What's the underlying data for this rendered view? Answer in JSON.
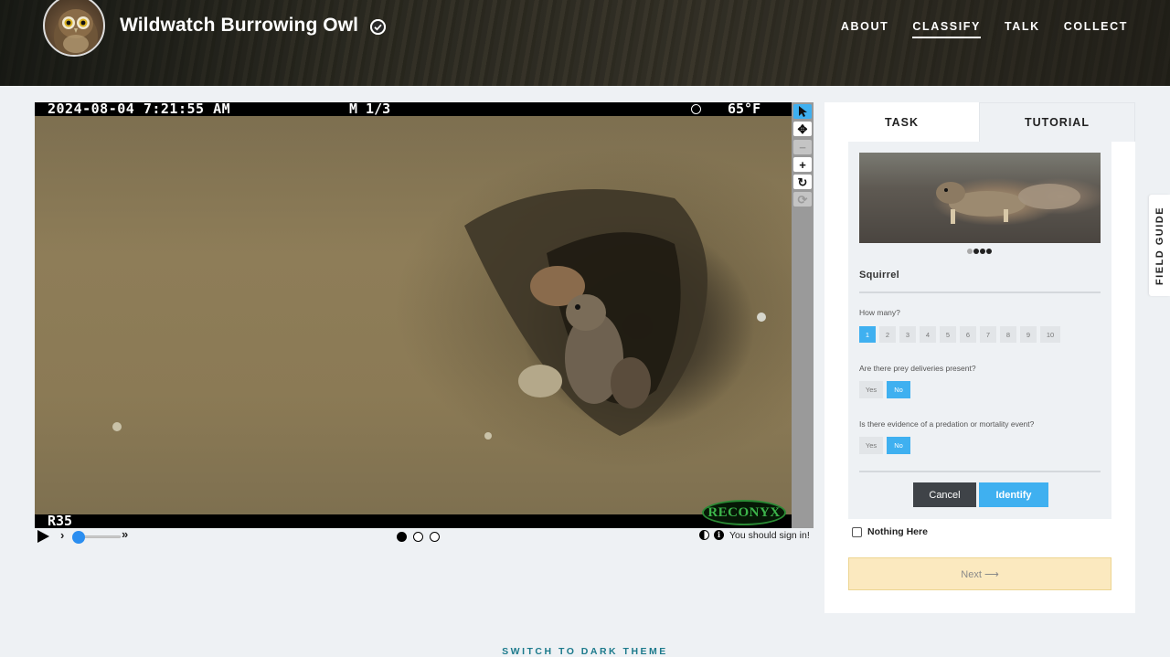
{
  "header": {
    "title": "Wildwatch Burrowing Owl",
    "avatar_icon": "burrowing-owl-avatar",
    "verified_icon": "check-circle-icon",
    "nav": [
      {
        "label": "ABOUT",
        "active": false
      },
      {
        "label": "CLASSIFY",
        "active": true
      },
      {
        "label": "TALK",
        "active": false
      },
      {
        "label": "COLLECT",
        "active": false
      }
    ]
  },
  "viewer": {
    "camera_date": "2024-08-04 7:21:55 AM",
    "camera_mode": "M 1/3",
    "camera_temp": "65°F",
    "camera_id": "R35",
    "camera_brand": "RECONYX",
    "tools": [
      "pointer-icon",
      "pan-icon",
      "zoom-out-icon",
      "zoom-in-icon",
      "rotate-icon",
      "reset-icon"
    ],
    "frame_count": 3,
    "current_frame": 1,
    "speed_slow": "›",
    "speed_fast": "»",
    "signin_note": "You should sign in!"
  },
  "task": {
    "tabs": [
      "TASK",
      "TUTORIAL"
    ],
    "active_tab": "TASK",
    "choice": "Squirrel",
    "carousel_dots": 4,
    "carousel_active": 1,
    "q_how_many": "How many?",
    "counts": [
      "1",
      "2",
      "3",
      "4",
      "5",
      "6",
      "7",
      "8",
      "9",
      "10"
    ],
    "selected_count": "1",
    "q_prey": "Are there prey deliveries present?",
    "q_predation": "Is there evidence of a predation or mortality event?",
    "yes_label": "Yes",
    "no_label": "No",
    "prey_answer": "No",
    "predation_answer": "No",
    "cancel_label": "Cancel",
    "identify_label": "Identify",
    "nothing_here_label": "Nothing Here",
    "next_label": "Next ⟶"
  },
  "field_guide_label": "FIELD GUIDE",
  "theme_toggle_label": "SWITCH TO DARK THEME",
  "colors": {
    "accent": "#3fb0f0",
    "next_bg": "#fbe9bf",
    "page_bg": "#eef1f4",
    "theme_link": "#1c7a8c"
  }
}
